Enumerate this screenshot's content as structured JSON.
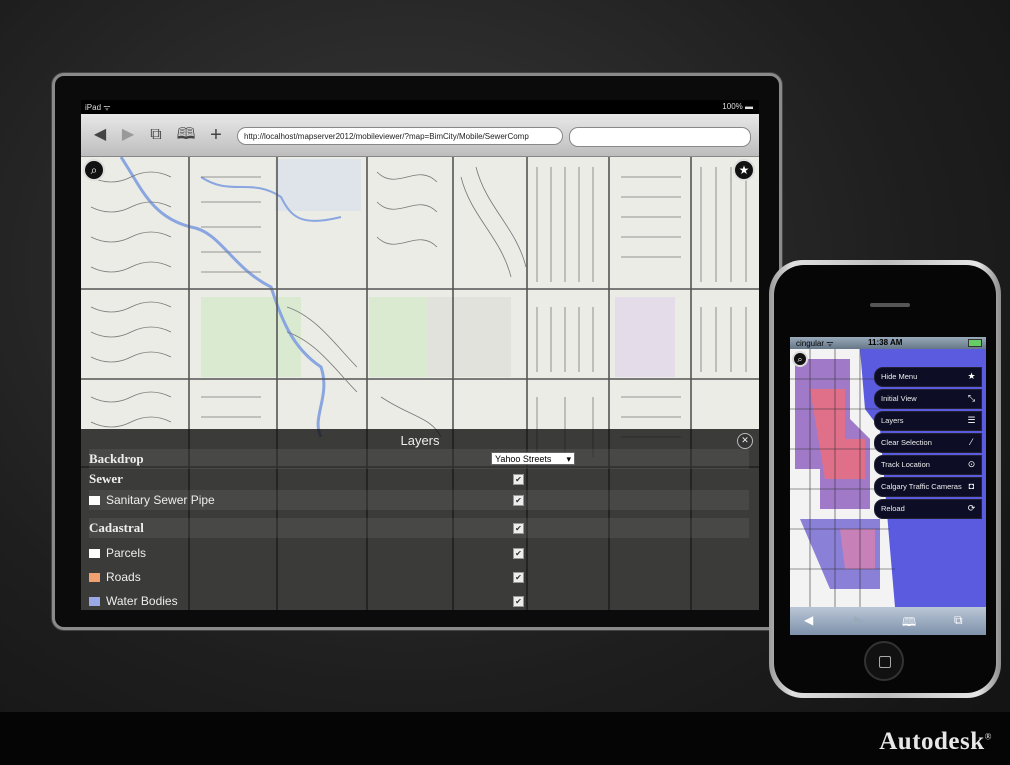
{
  "brand": {
    "name": "Autodesk",
    "mark": "®"
  },
  "ipad": {
    "status_left": "iPad ᯤ",
    "status_right": "100%",
    "url": "http://localhost/mapserver2012/mobileviewer/?map=BimCity/Mobile/SewerComp",
    "layers_panel": {
      "title": "Layers",
      "backdrop_label": "Backdrop",
      "backdrop_value": "Yahoo Streets",
      "groups": [
        {
          "name": "Sewer",
          "items": [
            {
              "label": "Sanitary Sewer Pipe",
              "swatch": "#ffffff",
              "checked": true
            }
          ]
        },
        {
          "name": "Cadastral",
          "items": [
            {
              "label": "Parcels",
              "swatch": "#ffffff",
              "checked": true
            },
            {
              "label": "Roads",
              "swatch": "#f0a070",
              "checked": true
            },
            {
              "label": "Water Bodies",
              "swatch": "#9aa8e8",
              "checked": true
            }
          ]
        }
      ]
    }
  },
  "iphone": {
    "carrier": "cingular ᯤ",
    "time": "11:38 AM",
    "menu": [
      {
        "label": "Hide Menu",
        "icon": "star-icon"
      },
      {
        "label": "Initial View",
        "icon": "arrow-icon"
      },
      {
        "label": "Layers",
        "icon": "list-icon"
      },
      {
        "label": "Clear Selection",
        "icon": "eraser-icon"
      },
      {
        "label": "Track Location",
        "icon": "target-icon"
      },
      {
        "label": "Calgary Traffic Cameras",
        "icon": "camera-icon"
      },
      {
        "label": "Reload",
        "icon": "reload-icon"
      }
    ]
  }
}
